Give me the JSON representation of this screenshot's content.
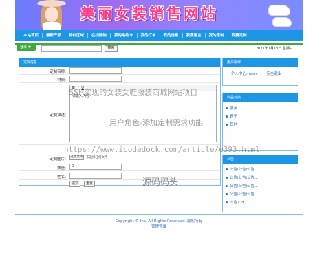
{
  "banner": {
    "title": "美丽女装销售网站"
  },
  "nav": {
    "items": [
      {
        "label": "本站首页"
      },
      {
        "label": "最新产品"
      },
      {
        "label": "特价区域"
      },
      {
        "label": "在线购物"
      },
      {
        "label": "我的购物车"
      },
      {
        "label": "我的订单"
      },
      {
        "label": "我的信息"
      },
      {
        "label": "我要留言"
      },
      {
        "label": "我的定制"
      },
      {
        "label": "我要定制"
      }
    ]
  },
  "topbar": {
    "login_label": "登录",
    "search_button": "搜索",
    "date": "2021年1月13日 星期三"
  },
  "form": {
    "header": "定制信息",
    "name_label": "定制名称:",
    "material_label": "材质:",
    "desc_label": "定制描述:",
    "editor_text": "请输入内容",
    "image_label": "定制图片:",
    "file_button": "选择文件",
    "file_status": "未选择任何文件",
    "qty_label": "数量:",
    "qty_value": "0",
    "realname_label": "姓名:",
    "submit": "提交",
    "reset": "重置"
  },
  "sidebar": {
    "user_header": "用户操作",
    "user_center": "个人中心: user",
    "logout": "安全退出",
    "category_header": "商品分类",
    "categories": [
      "服装",
      "鞋子",
      "其他"
    ],
    "notice_header": "公告",
    "notices": [
      "公告i公告i公告...",
      "公告i公告i公告...",
      "公告i公告i公告...",
      "公告i公告i公告...",
      "公告1297..."
    ]
  },
  "footer": {
    "copyright": "Copyright © Inc. All Rights Reserved. 版权所有",
    "admin_login": "管理登录"
  },
  "watermarks": {
    "line1": "SSH实现的女装女鞋服装商城网站项目",
    "line2": "用户角色-添加定制需求功能",
    "line3": "https://www.icodedock.com/article/e393.html",
    "line4": "源码码头"
  }
}
